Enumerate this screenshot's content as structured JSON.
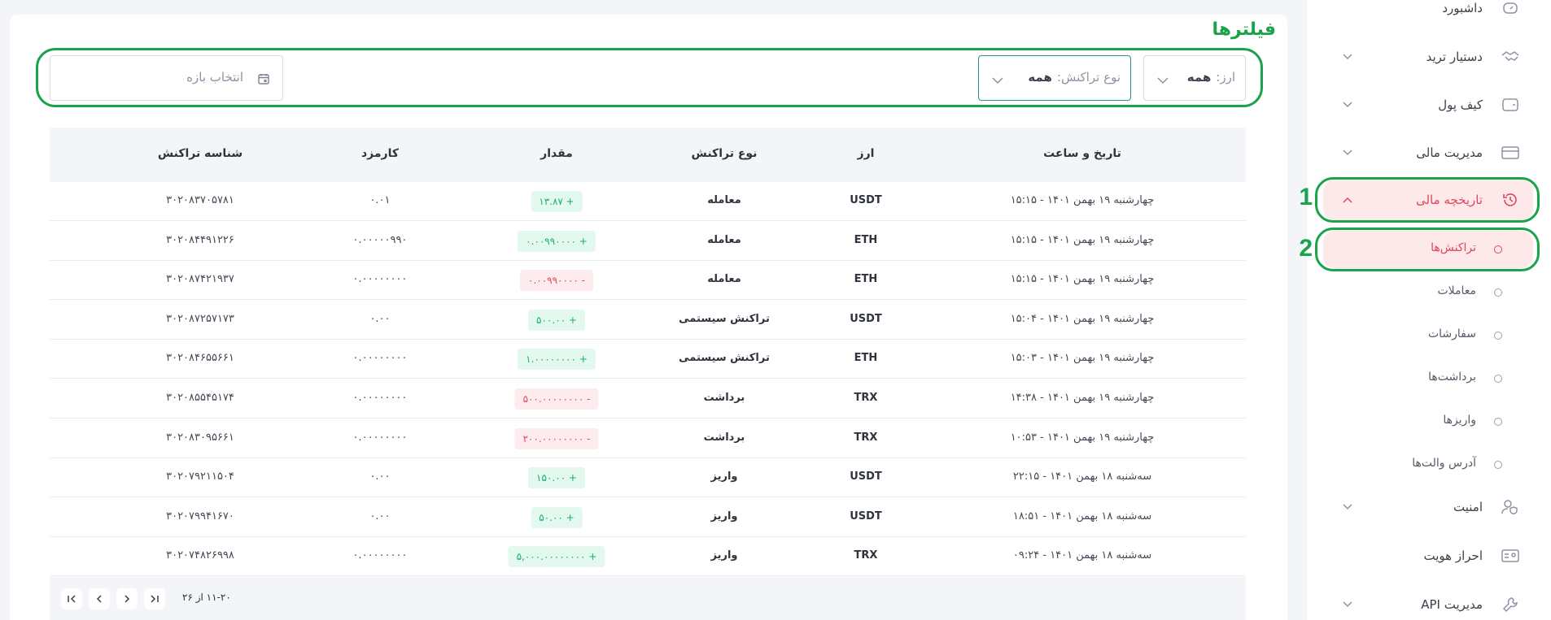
{
  "sidebar": {
    "items": [
      {
        "label": "داشبورد"
      },
      {
        "label": "دستیار ترید"
      },
      {
        "label": "کیف پول"
      },
      {
        "label": "مدیریت مالی"
      },
      {
        "label": "تاریخچه مالی"
      },
      {
        "label": "امنیت"
      },
      {
        "label": "احراز هویت"
      },
      {
        "label": "مدیریت API"
      }
    ],
    "sub_items": [
      {
        "label": "تراکنش‌ها"
      },
      {
        "label": "معاملات"
      },
      {
        "label": "سفارشات"
      },
      {
        "label": "برداشت‌ها"
      },
      {
        "label": "واریزها"
      },
      {
        "label": "آدرس والت‌ها"
      }
    ],
    "markers": [
      "1",
      "2"
    ]
  },
  "filters": {
    "title": "فیلترها",
    "currency": {
      "label": "ارز:",
      "value": "همه"
    },
    "type": {
      "label": "نوع تراکنش:",
      "value": "همه"
    },
    "date": {
      "placeholder": "انتخاب بازه"
    }
  },
  "table": {
    "headers": {
      "datetime": "تاریخ و ساعت",
      "currency": "ارز",
      "type": "نوع تراکنش",
      "amount": "مقدار",
      "fee": "کارمزد",
      "txid": "شناسه تراکنش"
    },
    "rows": [
      {
        "datetime": "چهارشنبه ۱۹ بهمن ۱۴۰۱ - ۱۵:۱۵",
        "currency": "USDT",
        "type": "معامله",
        "amount": "+ ۱۳.۸۷",
        "fee": "۰.۰۱",
        "txid": "۳۰۲۰۸۳۷۰۵۷۸۱"
      },
      {
        "datetime": "چهارشنبه ۱۹ بهمن ۱۴۰۱ - ۱۵:۱۵",
        "currency": "ETH",
        "type": "معامله",
        "amount": "+ ۰.۰۰۹۹۰۰۰۰",
        "fee": "۰.۰۰۰۰۰۹۹۰",
        "txid": "۳۰۲۰۸۴۴۹۱۲۲۶"
      },
      {
        "datetime": "چهارشنبه ۱۹ بهمن ۱۴۰۱ - ۱۵:۱۵",
        "currency": "ETH",
        "type": "معامله",
        "amount": "- ۰.۰۰۹۹۰۰۰۰",
        "fee": "۰.۰۰۰۰۰۰۰۰",
        "txid": "۳۰۲۰۸۷۴۲۱۹۳۷"
      },
      {
        "datetime": "چهارشنبه ۱۹ بهمن ۱۴۰۱ - ۱۵:۰۴",
        "currency": "USDT",
        "type": "تراکنش سیستمی",
        "amount": "+ ۵۰۰.۰۰",
        "fee": "۰.۰۰",
        "txid": "۳۰۲۰۸۷۲۵۷۱۷۳"
      },
      {
        "datetime": "چهارشنبه ۱۹ بهمن ۱۴۰۱ - ۱۵:۰۳",
        "currency": "ETH",
        "type": "تراکنش سیستمی",
        "amount": "+ ۱.۰۰۰۰۰۰۰۰",
        "fee": "۰.۰۰۰۰۰۰۰۰",
        "txid": "۳۰۲۰۸۴۶۵۵۶۶۱"
      },
      {
        "datetime": "چهارشنبه ۱۹ بهمن ۱۴۰۱ - ۱۴:۳۸",
        "currency": "TRX",
        "type": "برداشت",
        "amount": "- ۵۰۰.۰۰۰۰۰۰۰۰",
        "fee": "۰.۰۰۰۰۰۰۰۰",
        "txid": "۳۰۲۰۸۵۵۴۵۱۷۴"
      },
      {
        "datetime": "چهارشنبه ۱۹ بهمن ۱۴۰۱ - ۱۰:۵۳",
        "currency": "TRX",
        "type": "برداشت",
        "amount": "- ۲۰۰.۰۰۰۰۰۰۰۰",
        "fee": "۰.۰۰۰۰۰۰۰۰",
        "txid": "۳۰۲۰۸۳۰۹۵۶۶۱"
      },
      {
        "datetime": "سه‌شنبه ۱۸ بهمن ۱۴۰۱ - ۲۲:۱۵",
        "currency": "USDT",
        "type": "واریز",
        "amount": "+ ۱۵۰.۰۰",
        "fee": "۰.۰۰",
        "txid": "۳۰۲۰۷۹۲۱۱۵۰۴"
      },
      {
        "datetime": "سه‌شنبه ۱۸ بهمن ۱۴۰۱ - ۱۸:۵۱",
        "currency": "USDT",
        "type": "واریز",
        "amount": "+ ۵۰.۰۰",
        "fee": "۰.۰۰",
        "txid": "۳۰۲۰۷۹۹۴۱۶۷۰"
      },
      {
        "datetime": "سه‌شنبه ۱۸ بهمن ۱۴۰۱ - ۰۹:۲۴",
        "currency": "TRX",
        "type": "واریز",
        "amount": "+ ۵,۰۰۰.۰۰۰۰۰۰۰۰",
        "fee": "۰.۰۰۰۰۰۰۰۰",
        "txid": "۳۰۲۰۷۴۸۲۶۹۹۸"
      }
    ]
  },
  "pagination": {
    "text": "۱۱-۲۰ از ۲۶"
  },
  "colors": {
    "accent": "#e2465c",
    "highlight": "#1aa34a",
    "positive": "#17b26a"
  }
}
